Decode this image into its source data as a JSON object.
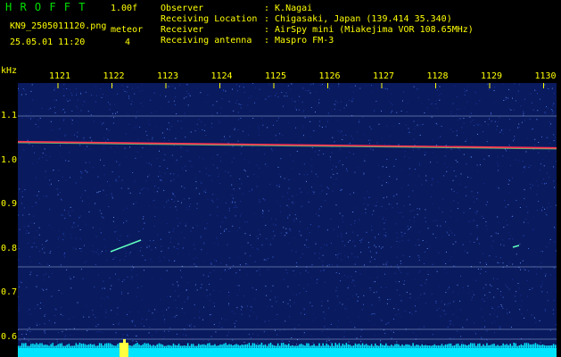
{
  "header": {
    "brand": "H R O F F T",
    "version": "1.00f",
    "filename": "KN9_2505011120.png",
    "datetime": "25.05.01 11:20",
    "meteor_label": "meteor",
    "meteor_count": "4",
    "info_keys": [
      "Observer",
      "Receiving Location",
      "Receiver",
      "Receiving antenna"
    ],
    "info_values": [
      ": K.Nagai",
      ": Chigasaki, Japan (139.414 35.340)",
      ": AirSpy mini (Miakejima VOR 108.65MHz)",
      ": Maspro FM-3"
    ]
  },
  "axis": {
    "unit": "kHz",
    "y_ticks": [
      "1.1",
      "1.0",
      "0.9",
      "0.8",
      "0.7",
      "0.6"
    ],
    "x_ticks": [
      "1121",
      "1122",
      "1123",
      "1124",
      "1125",
      "1126",
      "1127",
      "1128",
      "1129",
      "1130"
    ]
  },
  "colors": {
    "background": "#0a1a5e",
    "text_green": "#00e000",
    "text_yellow": "#ffff00",
    "noise_floor": "#00e5ff",
    "carrier": "#ff3050"
  }
}
